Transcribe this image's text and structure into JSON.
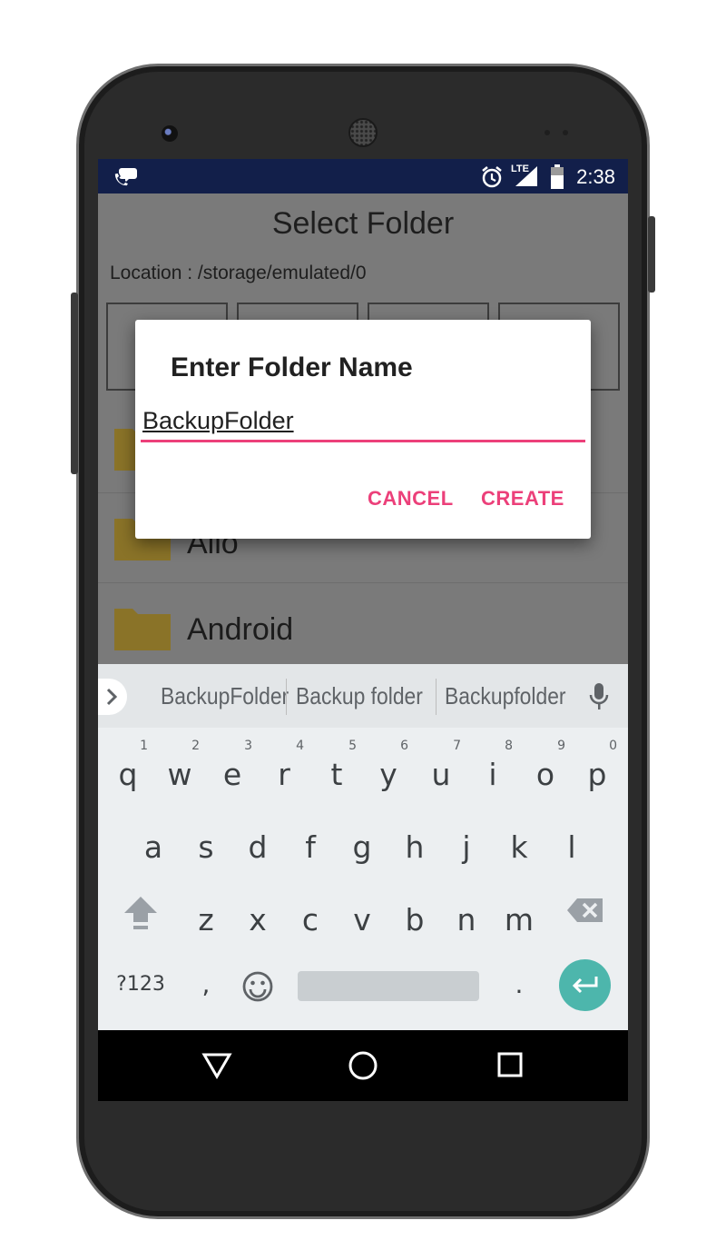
{
  "status_bar": {
    "time": "2:38",
    "network": "LTE"
  },
  "app": {
    "title": "Select Folder",
    "location": "Location : /storage/emulated/0",
    "folders": [
      "Allo",
      "Android"
    ]
  },
  "dialog": {
    "title": "Enter Folder Name",
    "input_value": "BackupFolder",
    "cancel_label": "CANCEL",
    "create_label": "CREATE"
  },
  "keyboard": {
    "suggestions": [
      "BackupFolder",
      "Backup folder",
      "Backupfolder"
    ],
    "row1": [
      {
        "ch": "q",
        "hint": "1"
      },
      {
        "ch": "w",
        "hint": "2"
      },
      {
        "ch": "e",
        "hint": "3"
      },
      {
        "ch": "r",
        "hint": "4"
      },
      {
        "ch": "t",
        "hint": "5"
      },
      {
        "ch": "y",
        "hint": "6"
      },
      {
        "ch": "u",
        "hint": "7"
      },
      {
        "ch": "i",
        "hint": "8"
      },
      {
        "ch": "o",
        "hint": "9"
      },
      {
        "ch": "p",
        "hint": "0"
      }
    ],
    "row2": [
      "a",
      "s",
      "d",
      "f",
      "g",
      "h",
      "j",
      "k",
      "l"
    ],
    "row3": [
      "z",
      "x",
      "c",
      "v",
      "b",
      "n",
      "m"
    ],
    "symbols_label": "?123",
    "comma": ",",
    "period": ".",
    "accent_color": "#4db6ac"
  },
  "colors": {
    "accent": "#ec407a",
    "status_bar": "#121f4a",
    "enter_key": "#4db6ac"
  }
}
